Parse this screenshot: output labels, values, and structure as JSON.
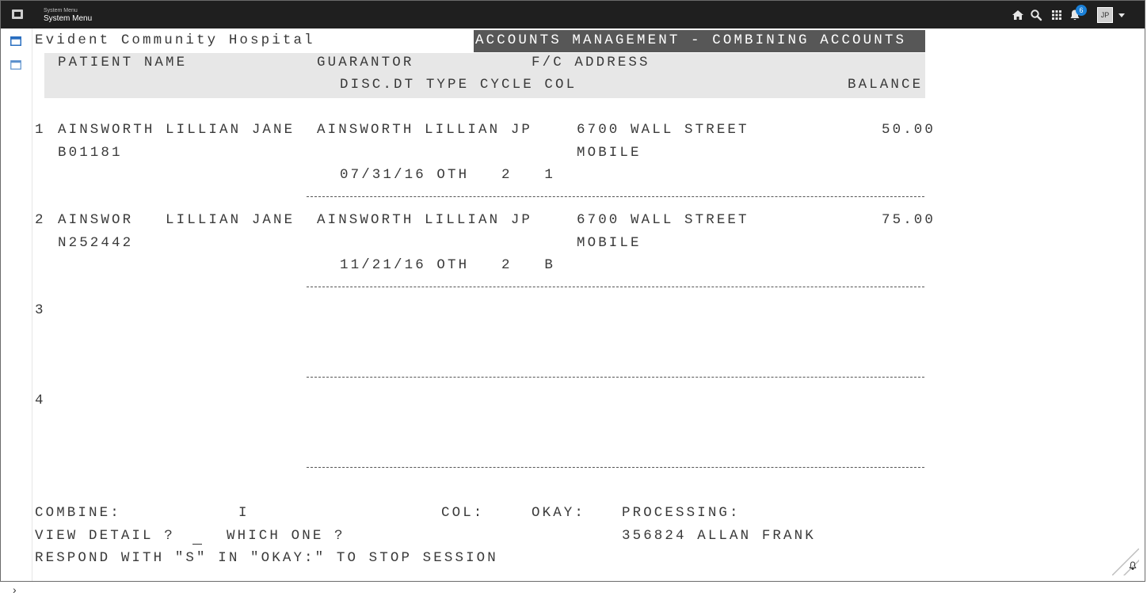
{
  "window": {
    "title_small": "System Menu",
    "title": "System Menu",
    "notification_count": "6",
    "user_initials": "JP"
  },
  "rail": {
    "expand_label": "›"
  },
  "terminal": {
    "facility": "Evident Community Hospital",
    "screen_title": "ACCOUNTS MANAGEMENT - COMBINING ACCOUNTS",
    "col_headers": {
      "patient_name": "PATIENT NAME",
      "guarantor": "GUARANTOR",
      "fc_address": "F/C ADDRESS",
      "disc_dt_type_cycle_col": "DISC.DT TYPE CYCLE COL",
      "balance": "BALANCE"
    },
    "rows": [
      {
        "num": "1",
        "patient": "AINSWORTH LILLIAN JANE",
        "guarantor": "AINSWORTH LILLIAN JP",
        "address1": "6700 WALL STREET",
        "balance": "50.00",
        "account": "B01181",
        "city": "MOBILE",
        "details": "07/31/16 OTH   2   1"
      },
      {
        "num": "2",
        "patient": "AINSWOR   LILLIAN JANE",
        "guarantor": "AINSWORTH LILLIAN JP",
        "address1": "6700 WALL STREET",
        "balance": "75.00",
        "account": "N252442",
        "city": "MOBILE",
        "details": "11/21/16 OTH   2   B"
      },
      {
        "num": "3"
      },
      {
        "num": "4"
      }
    ],
    "footer": {
      "combine_label": "COMBINE:",
      "combine_value": "I",
      "col_label": "COL:",
      "okay_label": "OKAY:",
      "processing_label": "PROCESSING:",
      "view_detail_label": "VIEW DETAIL ?",
      "which_one_label": "WHICH ONE ?",
      "processing_value": "356824 ALLAN FRANK",
      "instructions": "RESPOND WITH \"S\" IN \"OKAY:\" TO STOP SESSION"
    }
  },
  "colors": {
    "topbar": "#1f1f1f",
    "header_band": "#e7e7e7",
    "title_band": "#575757",
    "badge": "#1a7fd6"
  },
  "icons": [
    "app-icon",
    "home-icon",
    "search-icon",
    "apps-grid-icon",
    "bell-icon",
    "chevron-down-icon",
    "session-tab-icon",
    "expand-icon"
  ]
}
